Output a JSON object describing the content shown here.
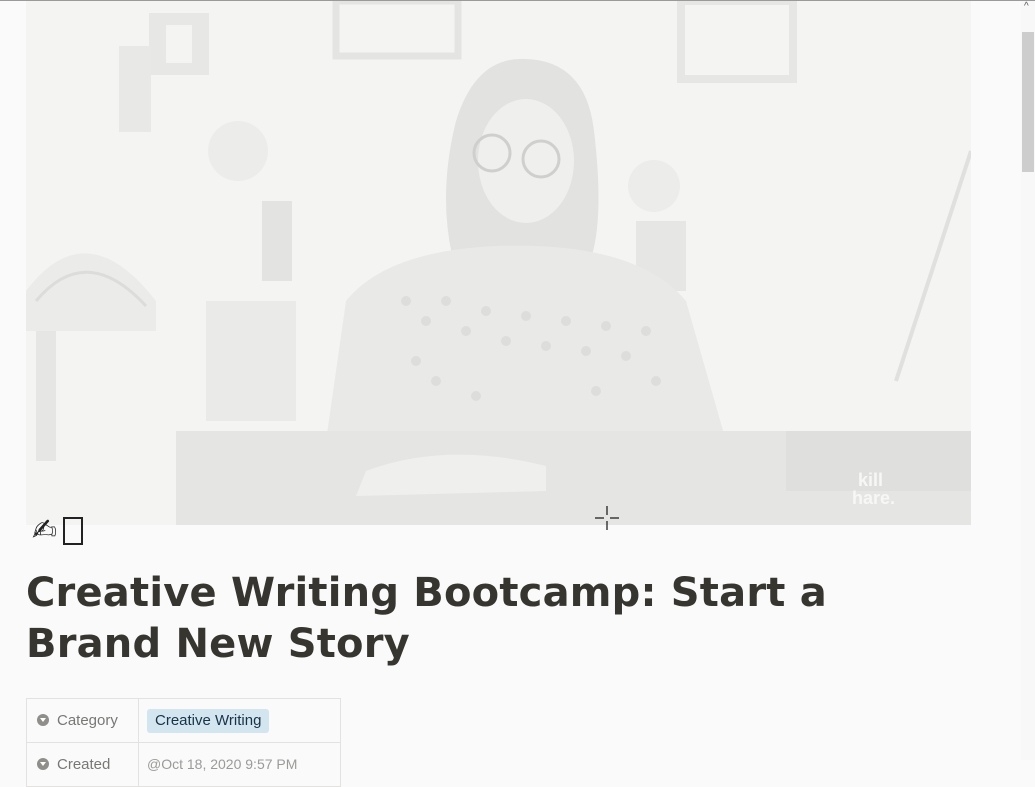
{
  "page": {
    "emoji_hand": "✍",
    "title": "Creative Writing Bootcamp: Start a Brand New Story",
    "cover_watermark": "kill\nhare."
  },
  "properties": [
    {
      "name": "Category",
      "icon": "select-icon",
      "value": "Creative Writing",
      "value_style": "tag",
      "tag_color": "#d3e5ef"
    },
    {
      "name": "Created",
      "icon": "clock-icon",
      "value": "@Oct 18, 2020 9:57 PM",
      "value_style": "text"
    }
  ],
  "colors": {
    "text": "#37352f",
    "muted": "#787774",
    "background": "#fafafa"
  }
}
